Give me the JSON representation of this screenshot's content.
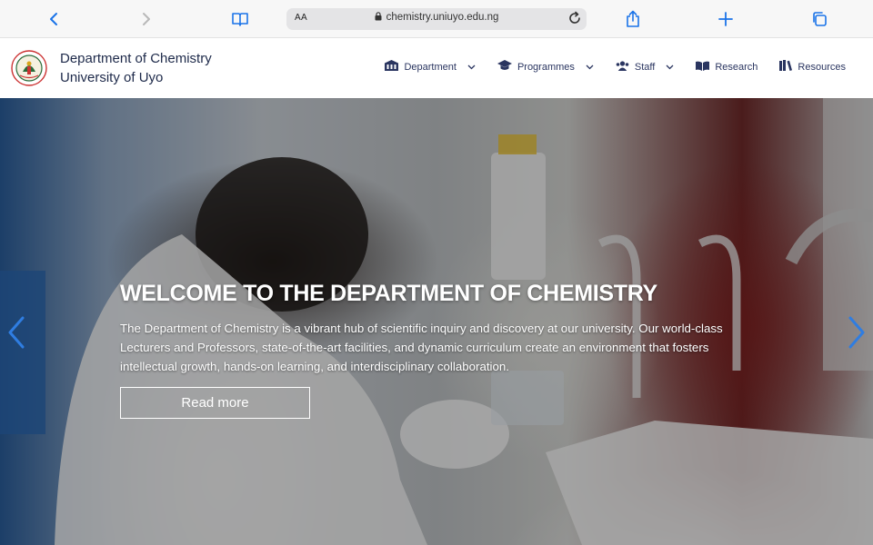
{
  "browser": {
    "aa_label": "AA",
    "url": "chemistry.uniuyo.edu.ng",
    "icons": [
      "back-icon",
      "forward-icon",
      "book-icon",
      "lock-icon",
      "reload-icon",
      "share-icon",
      "plus-icon",
      "tabs-icon"
    ]
  },
  "site": {
    "title_line1": "Department of Chemistry",
    "title_line2": "University of Uyo"
  },
  "nav": {
    "items": [
      {
        "label": "Department",
        "icon": "building-icon",
        "has_dropdown": true
      },
      {
        "label": "Programmes",
        "icon": "graduation-cap-icon",
        "has_dropdown": true
      },
      {
        "label": "Staff",
        "icon": "users-icon",
        "has_dropdown": true
      },
      {
        "label": "Research",
        "icon": "book-open-icon",
        "has_dropdown": false
      },
      {
        "label": "Resources",
        "icon": "library-icon",
        "has_dropdown": false
      }
    ]
  },
  "hero": {
    "title": "WELCOME TO THE DEPARTMENT OF CHEMISTRY",
    "text": "The Department of Chemistry is a vibrant hub of scientific inquiry and discovery at our university. Our world-class Lecturers and Professors, state-of-the-art facilities, and dynamic curriculum create an environment that fosters intellectual growth, hands-on learning, and interdisciplinary collaboration.",
    "button_label": "Read more"
  },
  "colors": {
    "accent": "#1a73e8",
    "nav_text": "#2a3560",
    "title_text": "#1e2a4a"
  }
}
